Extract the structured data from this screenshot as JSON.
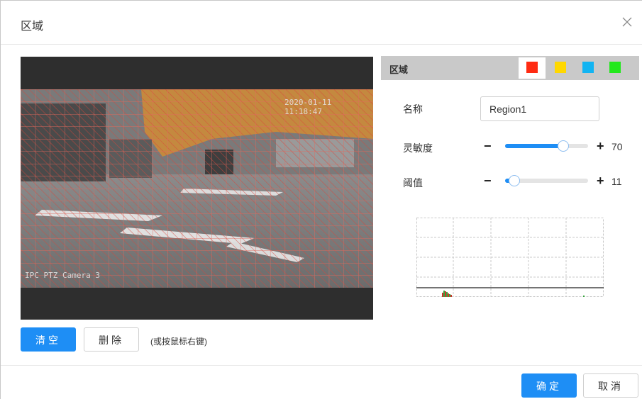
{
  "dialog": {
    "title": "区域",
    "close_icon": "close-icon"
  },
  "video": {
    "timestamp": "2020-01-11 11:18:47",
    "camera": "IPC PTZ Camera 3"
  },
  "toolbar": {
    "clear_label": "清空",
    "delete_label": "删除",
    "hint": "(或按鼠标右键)"
  },
  "region_panel": {
    "label": "区域",
    "colors": [
      "#ff2b12",
      "#ffd800",
      "#12b4f2",
      "#22e81c"
    ],
    "selected_index": 0
  },
  "settings": {
    "name_label": "名称",
    "name_value": "Region1",
    "sensitivity_label": "灵敏度",
    "sensitivity_value": "70",
    "sensitivity_fraction": 0.7,
    "threshold_label": "阈值",
    "threshold_value": "11",
    "threshold_fraction": 0.11,
    "minus": "−",
    "plus": "+"
  },
  "footer": {
    "ok_label": "确定",
    "cancel_label": "取消"
  },
  "colors": {
    "accent": "#1e8ef5",
    "grid": "#d9453a"
  }
}
